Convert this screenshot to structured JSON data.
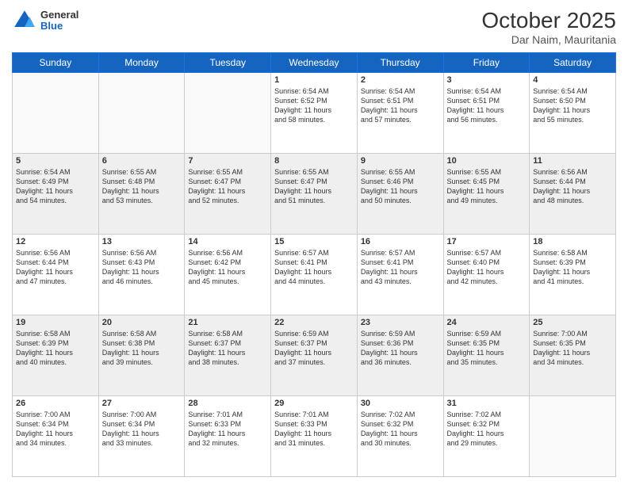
{
  "header": {
    "logo_general": "General",
    "logo_blue": "Blue",
    "month_title": "October 2025",
    "location": "Dar Naim, Mauritania"
  },
  "weekdays": [
    "Sunday",
    "Monday",
    "Tuesday",
    "Wednesday",
    "Thursday",
    "Friday",
    "Saturday"
  ],
  "weeks": [
    [
      {
        "day": "",
        "text": ""
      },
      {
        "day": "",
        "text": ""
      },
      {
        "day": "",
        "text": ""
      },
      {
        "day": "1",
        "text": "Sunrise: 6:54 AM\nSunset: 6:52 PM\nDaylight: 11 hours\nand 58 minutes."
      },
      {
        "day": "2",
        "text": "Sunrise: 6:54 AM\nSunset: 6:51 PM\nDaylight: 11 hours\nand 57 minutes."
      },
      {
        "day": "3",
        "text": "Sunrise: 6:54 AM\nSunset: 6:51 PM\nDaylight: 11 hours\nand 56 minutes."
      },
      {
        "day": "4",
        "text": "Sunrise: 6:54 AM\nSunset: 6:50 PM\nDaylight: 11 hours\nand 55 minutes."
      }
    ],
    [
      {
        "day": "5",
        "text": "Sunrise: 6:54 AM\nSunset: 6:49 PM\nDaylight: 11 hours\nand 54 minutes."
      },
      {
        "day": "6",
        "text": "Sunrise: 6:55 AM\nSunset: 6:48 PM\nDaylight: 11 hours\nand 53 minutes."
      },
      {
        "day": "7",
        "text": "Sunrise: 6:55 AM\nSunset: 6:47 PM\nDaylight: 11 hours\nand 52 minutes."
      },
      {
        "day": "8",
        "text": "Sunrise: 6:55 AM\nSunset: 6:47 PM\nDaylight: 11 hours\nand 51 minutes."
      },
      {
        "day": "9",
        "text": "Sunrise: 6:55 AM\nSunset: 6:46 PM\nDaylight: 11 hours\nand 50 minutes."
      },
      {
        "day": "10",
        "text": "Sunrise: 6:55 AM\nSunset: 6:45 PM\nDaylight: 11 hours\nand 49 minutes."
      },
      {
        "day": "11",
        "text": "Sunrise: 6:56 AM\nSunset: 6:44 PM\nDaylight: 11 hours\nand 48 minutes."
      }
    ],
    [
      {
        "day": "12",
        "text": "Sunrise: 6:56 AM\nSunset: 6:44 PM\nDaylight: 11 hours\nand 47 minutes."
      },
      {
        "day": "13",
        "text": "Sunrise: 6:56 AM\nSunset: 6:43 PM\nDaylight: 11 hours\nand 46 minutes."
      },
      {
        "day": "14",
        "text": "Sunrise: 6:56 AM\nSunset: 6:42 PM\nDaylight: 11 hours\nand 45 minutes."
      },
      {
        "day": "15",
        "text": "Sunrise: 6:57 AM\nSunset: 6:41 PM\nDaylight: 11 hours\nand 44 minutes."
      },
      {
        "day": "16",
        "text": "Sunrise: 6:57 AM\nSunset: 6:41 PM\nDaylight: 11 hours\nand 43 minutes."
      },
      {
        "day": "17",
        "text": "Sunrise: 6:57 AM\nSunset: 6:40 PM\nDaylight: 11 hours\nand 42 minutes."
      },
      {
        "day": "18",
        "text": "Sunrise: 6:58 AM\nSunset: 6:39 PM\nDaylight: 11 hours\nand 41 minutes."
      }
    ],
    [
      {
        "day": "19",
        "text": "Sunrise: 6:58 AM\nSunset: 6:39 PM\nDaylight: 11 hours\nand 40 minutes."
      },
      {
        "day": "20",
        "text": "Sunrise: 6:58 AM\nSunset: 6:38 PM\nDaylight: 11 hours\nand 39 minutes."
      },
      {
        "day": "21",
        "text": "Sunrise: 6:58 AM\nSunset: 6:37 PM\nDaylight: 11 hours\nand 38 minutes."
      },
      {
        "day": "22",
        "text": "Sunrise: 6:59 AM\nSunset: 6:37 PM\nDaylight: 11 hours\nand 37 minutes."
      },
      {
        "day": "23",
        "text": "Sunrise: 6:59 AM\nSunset: 6:36 PM\nDaylight: 11 hours\nand 36 minutes."
      },
      {
        "day": "24",
        "text": "Sunrise: 6:59 AM\nSunset: 6:35 PM\nDaylight: 11 hours\nand 35 minutes."
      },
      {
        "day": "25",
        "text": "Sunrise: 7:00 AM\nSunset: 6:35 PM\nDaylight: 11 hours\nand 34 minutes."
      }
    ],
    [
      {
        "day": "26",
        "text": "Sunrise: 7:00 AM\nSunset: 6:34 PM\nDaylight: 11 hours\nand 34 minutes."
      },
      {
        "day": "27",
        "text": "Sunrise: 7:00 AM\nSunset: 6:34 PM\nDaylight: 11 hours\nand 33 minutes."
      },
      {
        "day": "28",
        "text": "Sunrise: 7:01 AM\nSunset: 6:33 PM\nDaylight: 11 hours\nand 32 minutes."
      },
      {
        "day": "29",
        "text": "Sunrise: 7:01 AM\nSunset: 6:33 PM\nDaylight: 11 hours\nand 31 minutes."
      },
      {
        "day": "30",
        "text": "Sunrise: 7:02 AM\nSunset: 6:32 PM\nDaylight: 11 hours\nand 30 minutes."
      },
      {
        "day": "31",
        "text": "Sunrise: 7:02 AM\nSunset: 6:32 PM\nDaylight: 11 hours\nand 29 minutes."
      },
      {
        "day": "",
        "text": ""
      }
    ]
  ],
  "row_shading": [
    false,
    true,
    false,
    true,
    false
  ]
}
